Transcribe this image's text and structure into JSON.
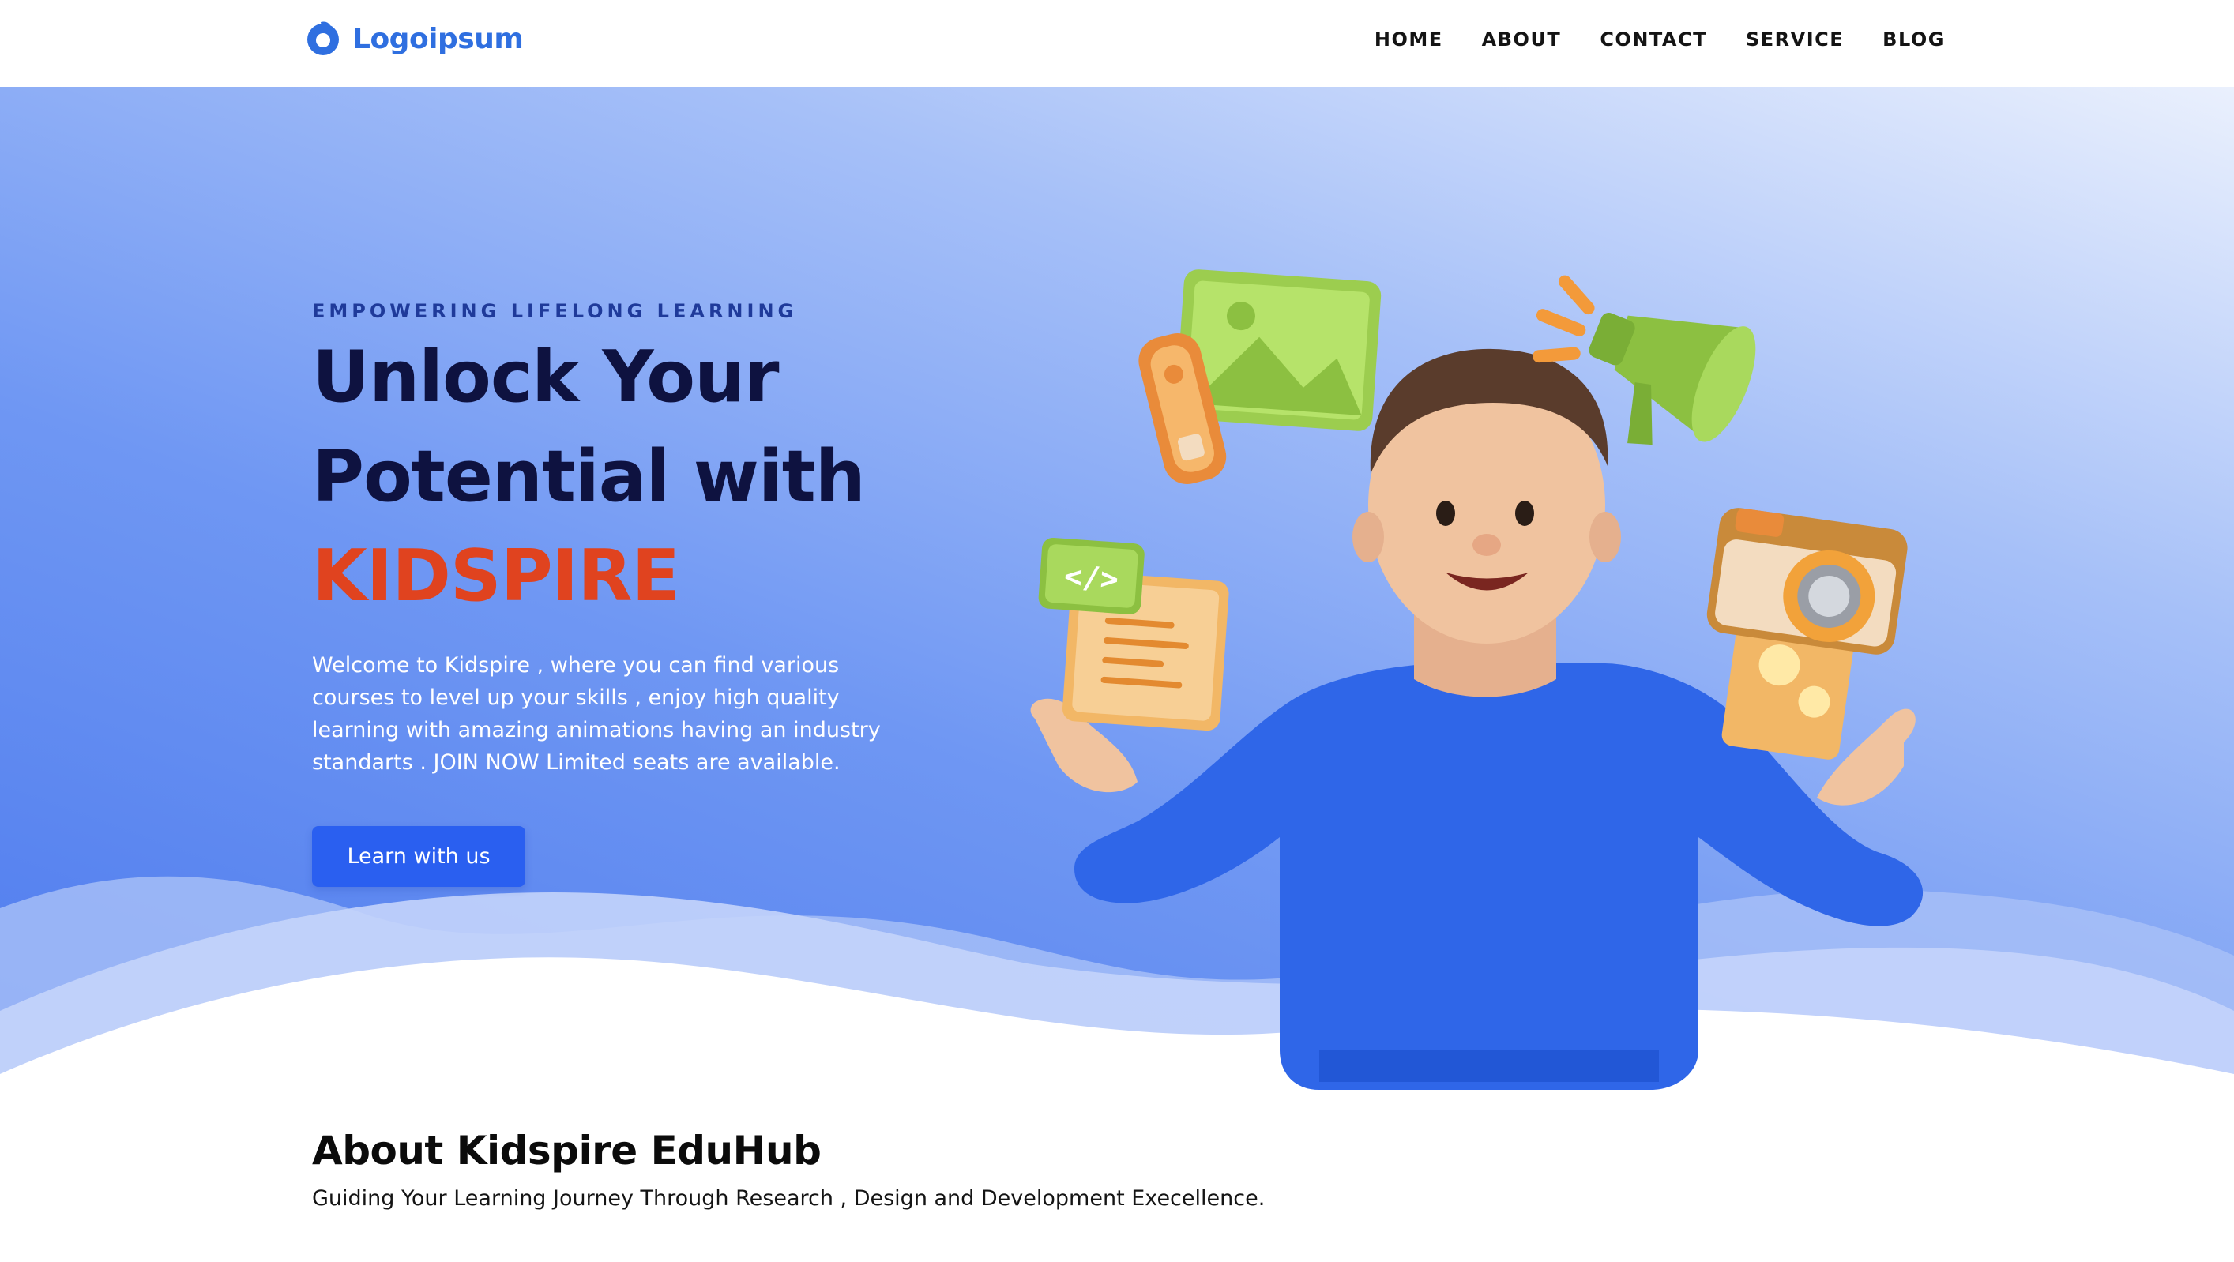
{
  "brand": {
    "logo_text": "Logoipsum",
    "logo_icon": "logo-ring-icon",
    "color": "#2f6fe0"
  },
  "nav": {
    "items": [
      "HOME",
      "ABOUT",
      "CONTACT",
      "SERVICE",
      "BLOG"
    ]
  },
  "hero": {
    "eyebrow": "EMPOWERING LIFELONG LEARNING",
    "headline_line1": "Unlock Your",
    "headline_line2": "Potential with",
    "headline_accent": "KIDSPIRE",
    "description": "Welcome to Kidspire , where you can find various courses to level up your skills , enjoy high quality learning with amazing animations having an industry standarts . JOIN NOW Limited seats are available.",
    "cta_label": "Learn with us",
    "illustration": "3d-character-juggling-icons",
    "colors": {
      "headline": "#0e1240",
      "accent": "#e0431f",
      "button": "#2a5ff0",
      "gradient_dark": "#4e7bee",
      "gradient_light": "#eaf0fd"
    }
  },
  "about": {
    "title": "About Kidspire EduHub",
    "subtitle": "Guiding Your Learning Journey Through Research , Design and Development Execellence."
  }
}
